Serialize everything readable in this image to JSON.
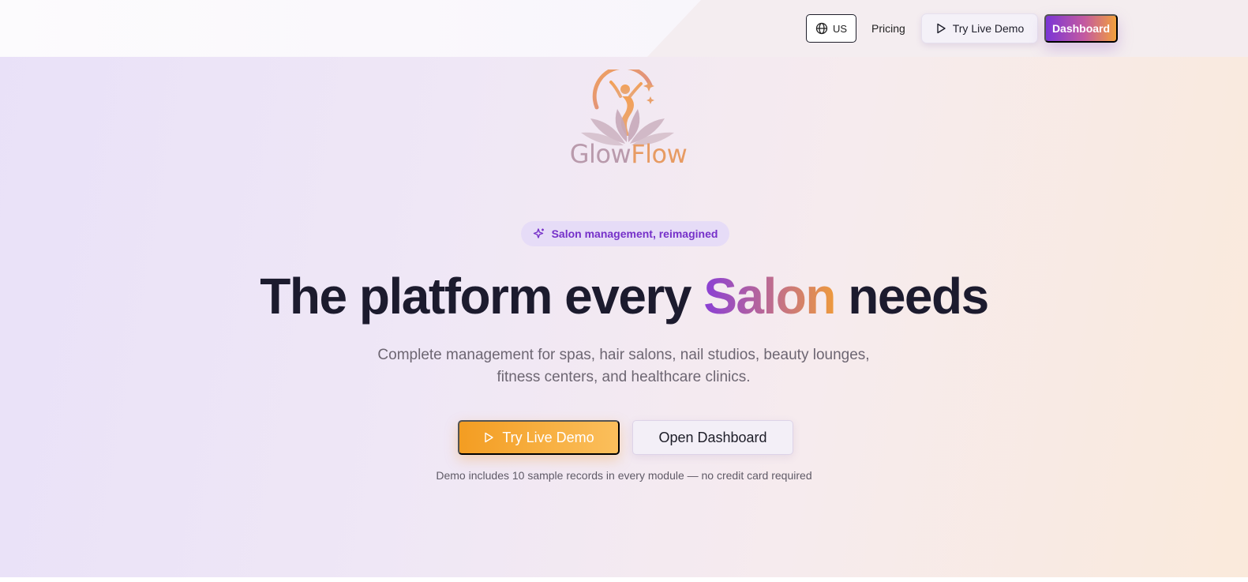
{
  "header": {
    "locale_label": "US",
    "pricing_label": "Pricing",
    "demo_label": "Try Live Demo",
    "dashboard_label": "Dashboard"
  },
  "logo": {
    "word1": "Glow",
    "word2": "Flow"
  },
  "hero": {
    "badge_label": "Salon management, reimagined",
    "headline_before": "The platform every ",
    "headline_accent": "Salon",
    "headline_after": " needs",
    "subhead_line1": "Complete management for spas, hair salons, nail studios, beauty lounges,",
    "subhead_line2": "fitness centers, and healthcare clinics.",
    "cta_demo_label": "Try Live Demo",
    "cta_dashboard_label": "Open Dashboard",
    "note": "Demo includes 10 sample records in every module — no credit card required"
  },
  "icons": {
    "locale": "globe-icon",
    "demo": "play-icon",
    "badge": "sparkles-icon"
  },
  "colors": {
    "brand_purple": "#7b35d6",
    "brand_orange": "#f39d22",
    "headline": "#1c1b2e",
    "badge_text": "#7631c9"
  }
}
